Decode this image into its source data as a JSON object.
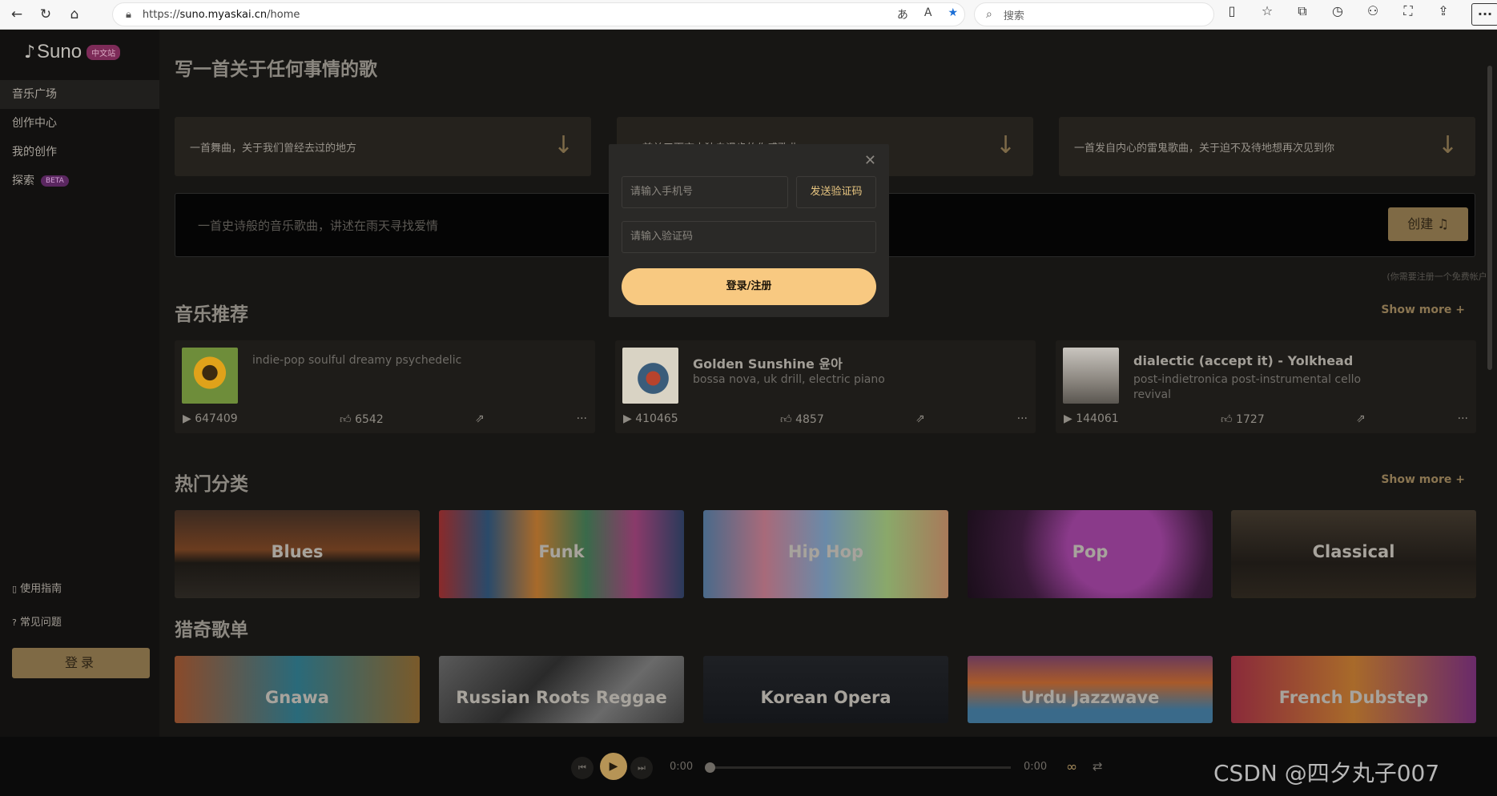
{
  "browser": {
    "url_prefix": "https://",
    "url_host": "suno.myaskai.cn",
    "url_path": "/home",
    "search_placeholder": "搜索"
  },
  "sidebar": {
    "logo": "Suno",
    "logo_badge": "中文站",
    "items": [
      {
        "label": "音乐广场",
        "active": true
      },
      {
        "label": "创作中心"
      },
      {
        "label": "我的创作"
      },
      {
        "label": "探索",
        "badge": "BETA"
      }
    ],
    "guide": "使用指南",
    "faq": "常见问题",
    "login": "登录"
  },
  "main": {
    "heading": "写一首关于任何事情的歌",
    "prompts": [
      "一首舞曲，关于我们曾经去过的地方",
      "一首关于雨夜中独自漫步的伤感歌曲",
      "一首发自内心的雷鬼歌曲，关于迫不及待地想再次见到你"
    ],
    "create_placeholder": "一首史诗般的音乐歌曲，讲述在雨天寻找爱情",
    "create_button": "创建",
    "signup_note": "(你需要注册一个免费帐户)",
    "recommend_title": "音乐推荐",
    "show_more": "Show more +",
    "songs": [
      {
        "title": "",
        "desc": "indie-pop soulful dreamy psychedelic",
        "plays": "647409",
        "likes": "6542"
      },
      {
        "title": "Golden Sunshine 윤아",
        "desc": "bossa nova, uk drill, electric piano",
        "plays": "410465",
        "likes": "4857"
      },
      {
        "title": "dialectic (accept it) - Yolkhead",
        "desc": "post-indietronica post-instrumental cello revival",
        "plays": "144061",
        "likes": "1727"
      }
    ],
    "hot_title": "热门分类",
    "hot": [
      "Blues",
      "Funk",
      "Hip Hop",
      "Pop",
      "Classical"
    ],
    "odd_title": "猎奇歌单",
    "odd": [
      "Gnawa",
      "Russian Roots Reggae",
      "Korean Opera",
      "Urdu Jazzwave",
      "French Dubstep"
    ]
  },
  "modal": {
    "phone_placeholder": "请输入手机号",
    "send_code": "发送验证码",
    "code_placeholder": "请输入验证码",
    "submit": "登录/注册"
  },
  "player": {
    "current": "0:00",
    "total": "0:00",
    "progress": 0
  },
  "watermark": "CSDN @四夕丸子007"
}
